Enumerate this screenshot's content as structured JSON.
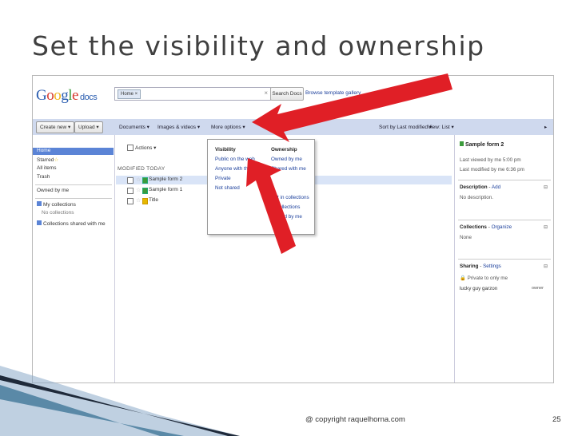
{
  "slide": {
    "title": "Set the visibility and ownership",
    "copyright": "@ copyright raquelhorna.com",
    "page_number": "25"
  },
  "app": {
    "logo_docs": "docs",
    "search_chip": "Home ×",
    "search_clear": "×",
    "search_button": "Search Docs",
    "browse_link": "Browse template gallery"
  },
  "toolbar": {
    "create_new": "Create new ▾",
    "upload": "Upload ▾",
    "documents": "Documents ▾",
    "images_videos": "Images & videos ▾",
    "more_options": "More options ▾",
    "sort": "Sort by Last modified ▾",
    "view": "View: List ▾"
  },
  "sidebar": {
    "home": "Home",
    "starred": "Starred",
    "all_items": "All items",
    "trash": "Trash",
    "owned_by_me": "Owned by me",
    "my_collections": "My collections",
    "no_collections": "No collections",
    "collections_shared": "Collections shared with me"
  },
  "list": {
    "actions": "Actions ▾",
    "section": "MODIFIED TODAY",
    "rows": [
      {
        "name": "Sample form 2"
      },
      {
        "name": "Sample form 1"
      },
      {
        "name": "Title"
      }
    ]
  },
  "dropdown": {
    "visibility_head": "Visibility",
    "visibility_items": [
      "Public on the web",
      "Anyone with the link",
      "Private",
      "Not shared"
    ],
    "ownership_head": "Ownership",
    "ownership_items": [
      "Owned by me",
      "Shared with me",
      "Not in collections",
      "In collections",
      "Owned by me"
    ]
  },
  "details": {
    "title": "Sample form 2",
    "last_viewed": "Last viewed by me 5:00 pm",
    "last_modified": "Last modified by me 6:36 pm",
    "description_label": "Description",
    "description_add": "Add",
    "description_value": "No description.",
    "collections_label": "Collections",
    "collections_organize": "Organize",
    "collections_value": "None",
    "sharing_label": "Sharing",
    "sharing_settings": "Settings",
    "sharing_private": "Private to only me",
    "owner_name": "lucky guy garzon",
    "owner_role": "owner"
  },
  "colors": {
    "arrow": "#e01f26",
    "toolbar": "#cfd9ee",
    "selection": "#5b84d6"
  }
}
